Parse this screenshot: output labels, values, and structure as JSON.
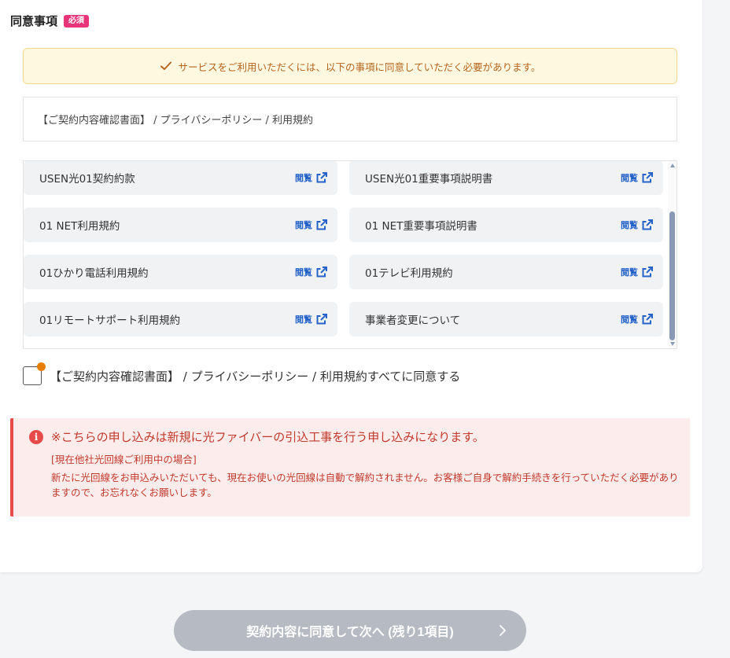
{
  "section": {
    "title": "同意事項",
    "badge": "必須"
  },
  "notice": {
    "text": "サービスをご利用いただくには、以下の事項に同意していただく必要があります。"
  },
  "doc_title": "【ご契約内容確認書面】 / プライバシーポリシー / 利用規約",
  "documents": {
    "link_label": "閲覧",
    "items": [
      {
        "name": "USEN光01契約約款"
      },
      {
        "name": "USEN光01重要事項説明書"
      },
      {
        "name": "01 NET利用規約"
      },
      {
        "name": "01 NET重要事項説明書"
      },
      {
        "name": "01ひかり電話利用規約"
      },
      {
        "name": "01テレビ利用規約"
      },
      {
        "name": "01リモートサポート利用規約"
      },
      {
        "name": "事業者変更について"
      }
    ]
  },
  "agree": {
    "label": "【ご契約内容確認書面】 / プライバシーポリシー / 利用規約すべてに同意する"
  },
  "alert": {
    "headline": "※こちらの申し込みは新規に光ファイバーの引込工事を行う申し込みになります。",
    "subhead": "[現在他社光回線ご利用中の場合]",
    "body": "新たに光回線をお申込みいただいても、現在お使いの光回線は自動で解約されません。お客様ご自身で解約手続きを行っていただく必要がありますので、お忘れなくお願いします。"
  },
  "next_button": {
    "label": "契約内容に同意して次へ (残り1項目)"
  },
  "colors": {
    "badge": "#e8357a",
    "link": "#2563c9",
    "alert": "#e64a4a",
    "notice_text": "#b5651d",
    "button_disabled": "#b6bac2"
  }
}
